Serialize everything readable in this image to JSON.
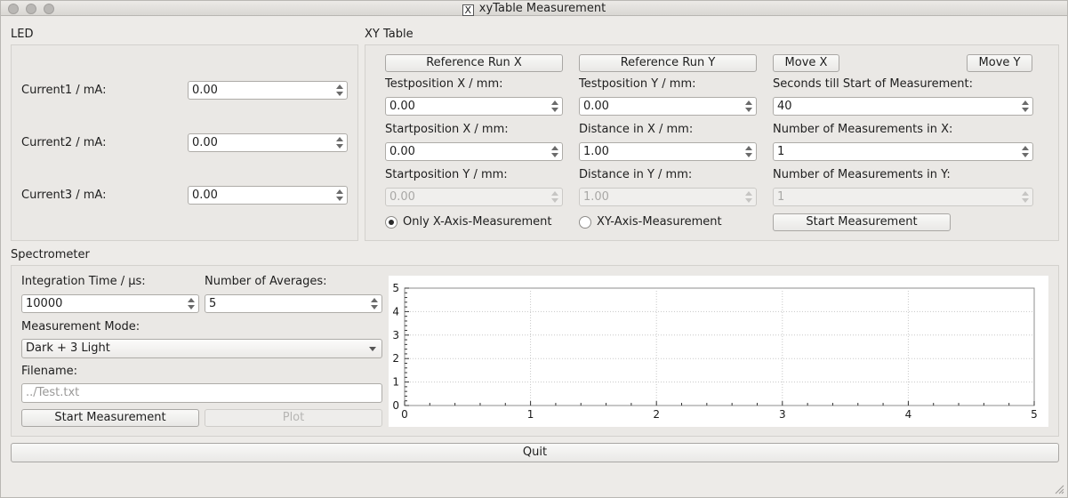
{
  "window": {
    "title": "xyTable Measurement",
    "logo": "X"
  },
  "led": {
    "title": "LED",
    "rows": [
      {
        "label": "Current1 / mA:",
        "value": "0.00"
      },
      {
        "label": "Current2 / mA:",
        "value": "0.00"
      },
      {
        "label": "Current3 / mA:",
        "value": "0.00"
      }
    ]
  },
  "xy": {
    "title": "XY Table",
    "ref_x": "Reference Run X",
    "ref_y": "Reference Run Y",
    "move_x": "Move X",
    "move_y": "Move Y",
    "test_x_label": "Testposition X / mm:",
    "test_x_value": "0.00",
    "test_y_label": "Testposition Y / mm:",
    "test_y_value": "0.00",
    "seconds_label": "Seconds till Start of Measurement:",
    "seconds_value": "40",
    "start_x_label": "Startposition X / mm:",
    "start_x_value": "0.00",
    "dist_x_label": "Distance in X / mm:",
    "dist_x_value": "1.00",
    "num_x_label": "Number of Measurements in X:",
    "num_x_value": "1",
    "start_y_label": "Startposition Y / mm:",
    "start_y_value": "0.00",
    "dist_y_label": "Distance in Y / mm:",
    "dist_y_value": "1.00",
    "num_y_label": "Number of Measurements in Y:",
    "num_y_value": "1",
    "radio_x_label": "Only X-Axis-Measurement",
    "radio_xy_label": "XY-Axis-Measurement",
    "radio_selected": "x",
    "start_btn": "Start Measurement"
  },
  "spectrometer": {
    "title": "Spectrometer",
    "integration_label": "Integration Time / µs:",
    "integration_value": "10000",
    "averages_label": "Number of Averages:",
    "averages_value": "5",
    "mode_label": "Measurement Mode:",
    "mode_value": "Dark + 3 Light",
    "filename_label": "Filename:",
    "filename_placeholder": "../Test.txt",
    "start_btn": "Start Measurement",
    "plot_btn": "Plot"
  },
  "chart_data": {
    "type": "line",
    "series": [],
    "xlim": [
      0,
      5
    ],
    "ylim": [
      0,
      5
    ],
    "x_ticks": [
      "0",
      "1",
      "2",
      "3",
      "4",
      "5"
    ],
    "y_ticks": [
      "0",
      "1",
      "2",
      "3",
      "4",
      "5"
    ],
    "grid": true
  },
  "footer": {
    "quit": "Quit"
  }
}
